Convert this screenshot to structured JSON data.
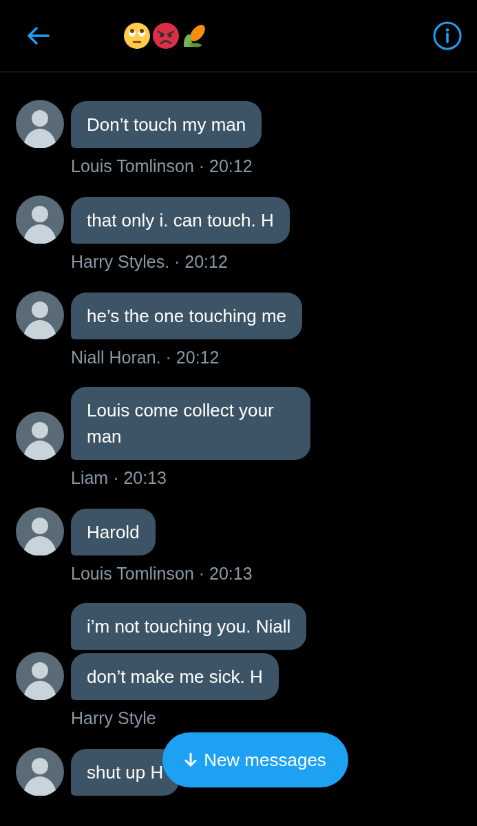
{
  "header": {
    "back": true,
    "info": true
  },
  "groups": [
    {
      "messages": [
        "Don’t touch my man"
      ],
      "meta": "Louis Tomlinson · 20:12"
    },
    {
      "messages": [
        "that only i. can touch. H"
      ],
      "meta": "Harry Styles. · 20:12"
    },
    {
      "messages": [
        "he’s the one touching me"
      ],
      "meta": "Niall Horan. · 20:12"
    },
    {
      "messages": [
        "Louis come collect your man"
      ],
      "meta": "Liam · 20:13"
    },
    {
      "messages": [
        "Harold"
      ],
      "meta": "Louis Tomlinson · 20:13"
    },
    {
      "messages": [
        "i’m not touching you. Niall",
        "don’t make me sick. H"
      ],
      "meta": "Harry Style"
    },
    {
      "messages": [
        "shut up H"
      ]
    }
  ],
  "new_messages_button": {
    "label": "New messages"
  }
}
